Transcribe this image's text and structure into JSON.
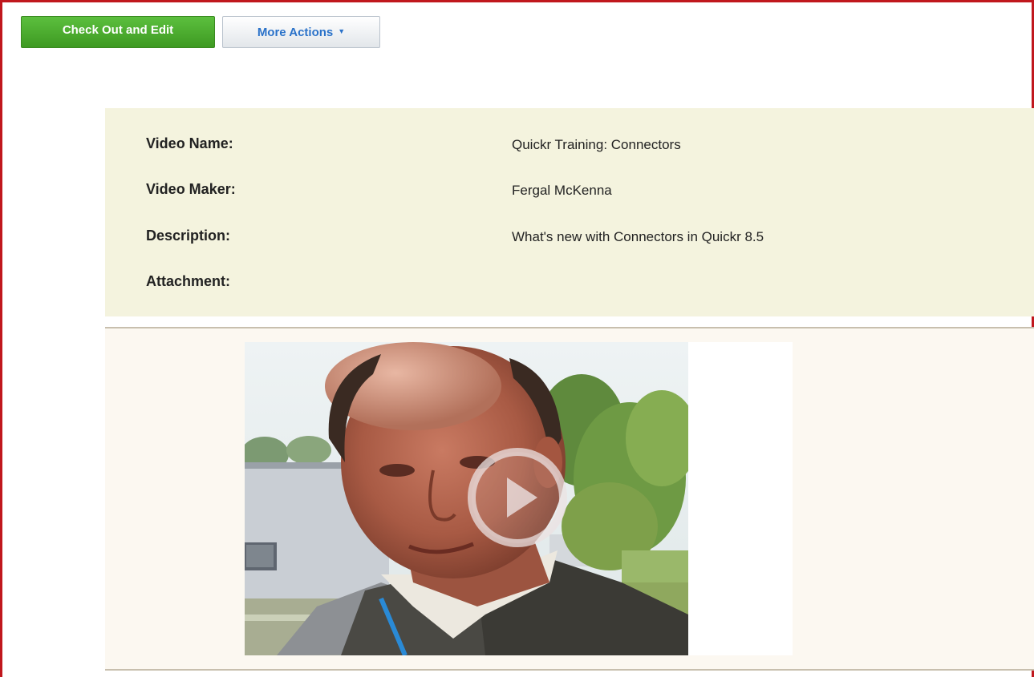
{
  "toolbar": {
    "checkout_label": "Check Out and Edit",
    "more_actions_label": "More Actions",
    "more_actions_icon": "caret-down-icon"
  },
  "details": {
    "fields": [
      {
        "label": "Video Name:",
        "value": "Quickr Training: Connectors"
      },
      {
        "label": "Video Maker:",
        "value": "Fergal McKenna"
      },
      {
        "label": "Description:",
        "value": "What's new with Connectors in Quickr 8.5"
      },
      {
        "label": "Attachment:",
        "value": ""
      }
    ]
  },
  "media": {
    "thumbnail": "video-thumbnail-person",
    "play_icon": "play-icon"
  },
  "colors": {
    "frame_border": "#c0171d",
    "details_bg": "#f4f3de",
    "media_bg": "#fcf8f1",
    "primary_button": "#4aa82c",
    "link_blue": "#2a72c9"
  }
}
